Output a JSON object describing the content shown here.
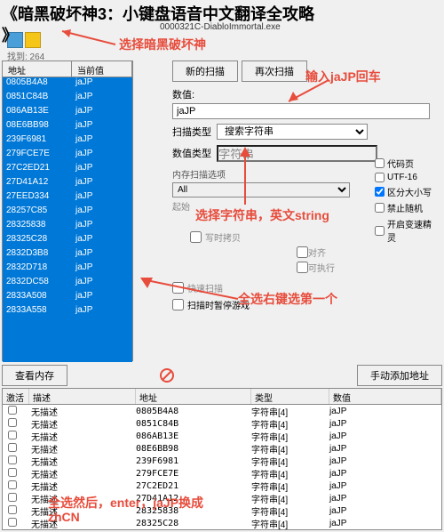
{
  "overlay": {
    "title_line1": "《暗黑破坏神3：小键盘语音中文翻译全攻略",
    "title_line2": "》",
    "exe_name": "0000321C-DiabloImmortal.exe",
    "file_count": "找到: 264"
  },
  "annotations": {
    "a1": "选择暗黑破坏神",
    "a2": "输入jaJP回车",
    "a3": "选择字符串，英文string",
    "a4": "全选右键选第一个",
    "a5": "全选然后，enter，jaJP换成",
    "a5b": "zhCN"
  },
  "left": {
    "header_addr": "地址",
    "header_val": "当前值",
    "rows": [
      {
        "addr": "0805B4A8",
        "val": "jaJP"
      },
      {
        "addr": "0851C84B",
        "val": "jaJP"
      },
      {
        "addr": "086AB13E",
        "val": "jaJP"
      },
      {
        "addr": "08E6BB98",
        "val": "jaJP"
      },
      {
        "addr": "239F6981",
        "val": "jaJP"
      },
      {
        "addr": "279FCE7E",
        "val": "jaJP"
      },
      {
        "addr": "27C2ED21",
        "val": "jaJP"
      },
      {
        "addr": "27D41A12",
        "val": "jaJP"
      },
      {
        "addr": "27EED334",
        "val": "jaJP"
      },
      {
        "addr": "28257C85",
        "val": "jaJP"
      },
      {
        "addr": "28325838",
        "val": "jaJP"
      },
      {
        "addr": "28325C28",
        "val": "jaJP"
      },
      {
        "addr": "2832D3B8",
        "val": "jaJP"
      },
      {
        "addr": "2832D718",
        "val": "jaJP"
      },
      {
        "addr": "2832DC58",
        "val": "jaJP"
      },
      {
        "addr": "2833A508",
        "val": "jaJP"
      },
      {
        "addr": "2833A558",
        "val": "jaJP"
      }
    ]
  },
  "scan": {
    "new_scan": "新的扫描",
    "rescan": "再次扫描",
    "value_label": "数值:",
    "value_input": "jaJP",
    "scan_type_label": "扫描类型",
    "scan_type_value": "搜索字符串",
    "value_type_label": "数值类型",
    "value_type_value": "字符串",
    "mem_scan_label": "内存扫描选项",
    "mem_all": "All",
    "start_label": "起始",
    "copy_write": "写时拷贝",
    "align": "对齐",
    "exec": "可执行",
    "fast_scan": "快速扫描",
    "scan_game": "扫描时暂停游戏"
  },
  "checks": {
    "codepage": "代码页",
    "utf16": "UTF-16",
    "case": "区分大小写",
    "random": "禁止随机",
    "speed": "开启变速精灵"
  },
  "bottom": {
    "view_mem": "查看内存",
    "add_addr": "手动添加地址"
  },
  "results": {
    "col_active": "激活",
    "col_desc": "描述",
    "col_addr": "地址",
    "col_type": "类型",
    "col_val": "数值",
    "nodesc": "无描述",
    "type_str": "字符串[4]",
    "rows": [
      {
        "addr": "0805B4A8",
        "val": "jaJP"
      },
      {
        "addr": "0851C84B",
        "val": "jaJP"
      },
      {
        "addr": "086AB13E",
        "val": "jaJP"
      },
      {
        "addr": "08E6BB98",
        "val": "jaJP"
      },
      {
        "addr": "239F6981",
        "val": "jaJP"
      },
      {
        "addr": "279FCE7E",
        "val": "jaJP"
      },
      {
        "addr": "27C2ED21",
        "val": "jaJP"
      },
      {
        "addr": "27D41A12",
        "val": "jaJP"
      },
      {
        "addr": "28325838",
        "val": "jaJP"
      },
      {
        "addr": "28325C28",
        "val": "jaJP"
      }
    ]
  }
}
